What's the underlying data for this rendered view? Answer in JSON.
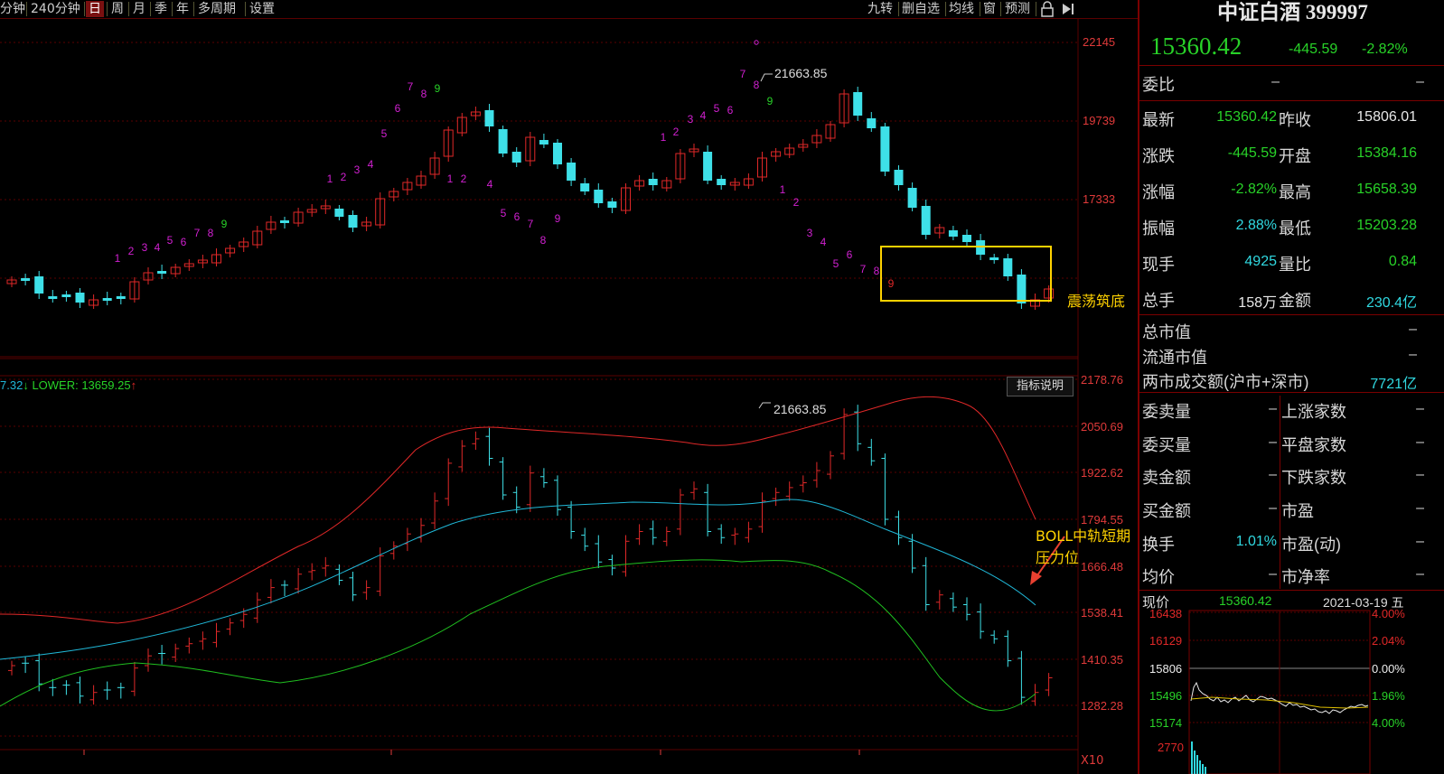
{
  "toolbar": {
    "left_items": [
      "分钟",
      "240分钟",
      "日",
      "周",
      "月",
      "季",
      "年",
      "多周期",
      "设置"
    ],
    "selected": "日",
    "right_items": [
      "九转",
      "删自选",
      "均线",
      "窗",
      "预测"
    ]
  },
  "price_axis": [
    "22145",
    "19739",
    "17333"
  ],
  "boll_axis": [
    "2178.76",
    "2050.69",
    "1922.62",
    "1794.55",
    "1666.48",
    "1538.41",
    "1410.35",
    "1282.28"
  ],
  "boll_legend": {
    "mid_text": "7.32",
    "lower_text": "LOWER: 13659.25",
    "up_arrow": "↑",
    "down_arrow": "↓"
  },
  "indicator_button": "指标说明",
  "annotations": {
    "peak_label": "21663.85",
    "peak_label_boll": "21663.85",
    "box_text": "震荡筑底",
    "boll_text": "BOLL中轨短期压力位"
  },
  "axis_scale_text": "X10",
  "quote": {
    "title": "中证白酒 399997",
    "price": "15360.42",
    "change": "-445.59",
    "change_pct": "-2.82%",
    "webi_label": "委比",
    "webi_value": "–",
    "webi_value2": "–"
  },
  "stats_rows": [
    {
      "l1": "最新",
      "v1": "15360.42",
      "c1": "g",
      "l2": "昨收",
      "v2": "15806.01",
      "c2": "w"
    },
    {
      "l1": "涨跌",
      "v1": "-445.59",
      "c1": "g",
      "l2": "开盘",
      "v2": "15384.16",
      "c2": "g"
    },
    {
      "l1": "涨幅",
      "v1": "-2.82%",
      "c1": "g",
      "l2": "最高",
      "v2": "15658.39",
      "c2": "g"
    },
    {
      "l1": "振幅",
      "v1": "2.88%",
      "c1": "c",
      "l2": "最低",
      "v2": "15203.28",
      "c2": "g"
    },
    {
      "l1": "现手",
      "v1": "4925",
      "c1": "c",
      "l2": "量比",
      "v2": "0.84",
      "c2": "g"
    },
    {
      "l1": "总手",
      "v1": "158万",
      "c1": "w",
      "l2": "金额",
      "v2": "230.4亿",
      "c2": "c"
    }
  ],
  "market": {
    "total_cap": "总市值",
    "float_cap": "流通市值",
    "turnover_label": "两市成交额(沪市+深市)",
    "turnover_value": "7721亿",
    "dash": "–"
  },
  "order_rows": [
    {
      "l1": "委卖量",
      "v1": "–",
      "l2": "上涨家数",
      "v2": "–"
    },
    {
      "l1": "委买量",
      "v1": "–",
      "l2": "平盘家数",
      "v2": "–"
    },
    {
      "l1": "卖金额",
      "v1": "–",
      "l2": "下跌家数",
      "v2": "–"
    },
    {
      "l1": "买金额",
      "v1": "–",
      "l2": "市盈",
      "v2": "–"
    },
    {
      "l1": "换手",
      "v1": "1.01%",
      "l2": "市盈(动)",
      "v2": "–"
    },
    {
      "l1": "均价",
      "v1": "–",
      "l2": "市净率",
      "v2": "–"
    }
  ],
  "mini": {
    "header_label": "现价",
    "header_price": "15360.42",
    "header_date": "2021-03-19 五",
    "left_axis": [
      "16438",
      "16129",
      "15806",
      "15496",
      "15174",
      "2770"
    ],
    "right_axis": [
      "4.00%",
      "2.04%",
      "0.00%",
      "1.96%",
      "4.00%"
    ]
  },
  "colors": {
    "up": "#e02828",
    "down": "#3ee0e8",
    "boll_up": "#e02828",
    "boll_mid": "#20b8d8",
    "boll_low": "#20c020",
    "grid": "#5a0000",
    "green": "#28d228",
    "magenta": "#d020d0",
    "yellow": "#ffd200"
  }
}
